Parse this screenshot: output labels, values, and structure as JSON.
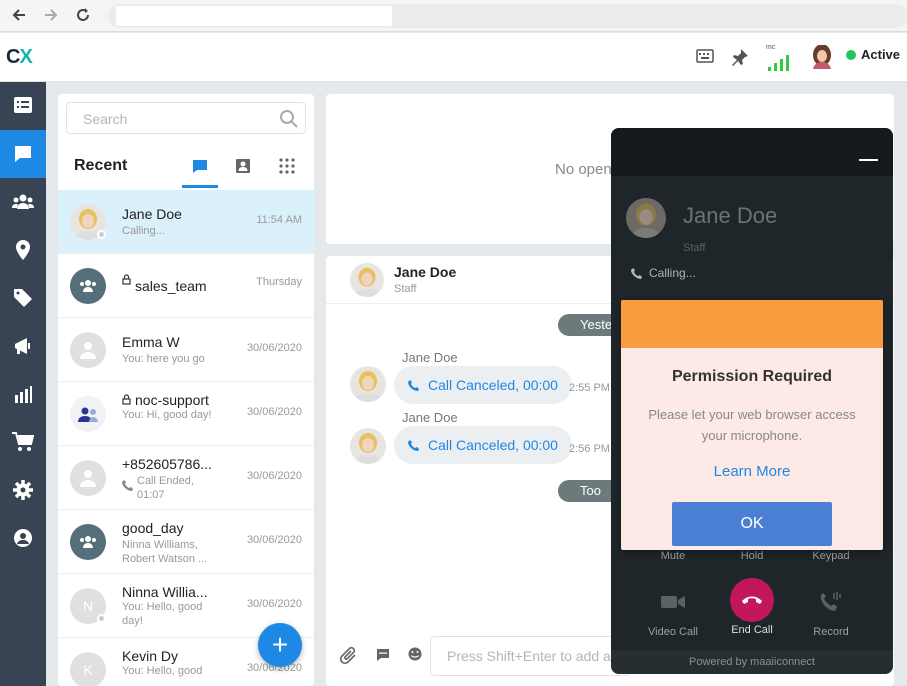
{
  "app": {
    "logo": "CX",
    "status": "Active",
    "signal_label": "mc"
  },
  "search": {
    "placeholder": "Search"
  },
  "list": {
    "heading": "Recent",
    "conversations": [
      {
        "name": "Jane Doe",
        "preview": "Calling...",
        "time": "11:54 AM"
      },
      {
        "name": "sales_team",
        "preview": "",
        "time": "Thursday"
      },
      {
        "name": "Emma W",
        "preview": "You: here you go",
        "time": "30/06/2020"
      },
      {
        "name": "noc-support",
        "preview": "You: Hi, good day!",
        "time": "30/06/2020"
      },
      {
        "name": "+852605786...",
        "preview": "Call Ended, 01:07",
        "time": "30/06/2020"
      },
      {
        "name": "good_day",
        "preview": "Ninna Williams, Robert Watson ...",
        "time": "30/06/2020"
      },
      {
        "name": "Ninna Willia...",
        "preview": "You: Hello, good day!",
        "time": "30/06/2020"
      },
      {
        "name": "Kevin Dy",
        "preview": "You: Hello, good",
        "time": "30/06/2020"
      }
    ],
    "avatar_letters": {
      "ninna": "N",
      "kevin": "K"
    },
    "fab_label": "+"
  },
  "main": {
    "empty_text": "No open"
  },
  "chat": {
    "contact_name": "Jane Doe",
    "contact_role": "Staff",
    "date_yesterday": "Yeste",
    "date_today": "Too",
    "messages": [
      {
        "sender": "Jane Doe",
        "text": "Call Canceled, 00:00",
        "time": "2:55 PM"
      },
      {
        "sender": "Jane Doe",
        "text": "Call Canceled, 00:00",
        "time": "2:56 PM"
      }
    ],
    "input_placeholder": "Press Shift+Enter to add a"
  },
  "call": {
    "name": "Jane Doe",
    "role": "Staff",
    "status": "Calling...",
    "controls": {
      "mute": "Mute",
      "hold": "Hold",
      "keypad": "Keypad",
      "video": "Video Call",
      "end": "End Call",
      "record": "Record"
    },
    "powered_by": "Powered by maaiiconnect"
  },
  "modal": {
    "title": "Permission Required",
    "body": "Please let your web browser access your microphone.",
    "link": "Learn More",
    "ok": "OK"
  },
  "colors": {
    "accent": "#1e88e5",
    "sidebar": "#384454",
    "modal_header": "#fb9b3f",
    "end_call": "#c2185b",
    "status": "#22c55e"
  }
}
